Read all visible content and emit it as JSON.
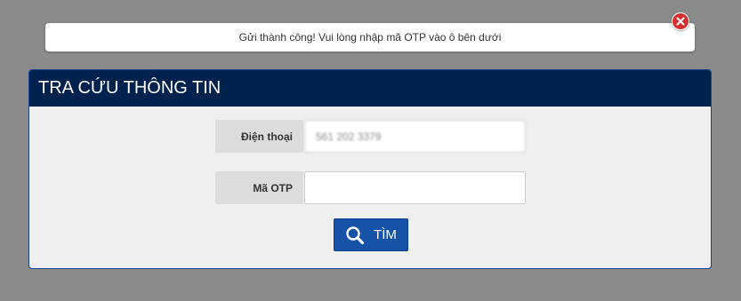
{
  "notification": {
    "message": "Gửi thành công! Vui lòng nhập mã OTP vào ô bên dưới"
  },
  "lookup": {
    "title": "TRA CỨU THÔNG TIN",
    "phone_label": "Điện thoại",
    "phone_value": "561 202 3379",
    "otp_label": "Mã OTP",
    "otp_value": "",
    "search_label": "TÌM"
  },
  "colors": {
    "header_bg": "#00224f",
    "button_bg": "#1652a8",
    "close_icon": "#d32f2f"
  },
  "icons": {
    "close": "close-icon",
    "search": "search-icon"
  }
}
